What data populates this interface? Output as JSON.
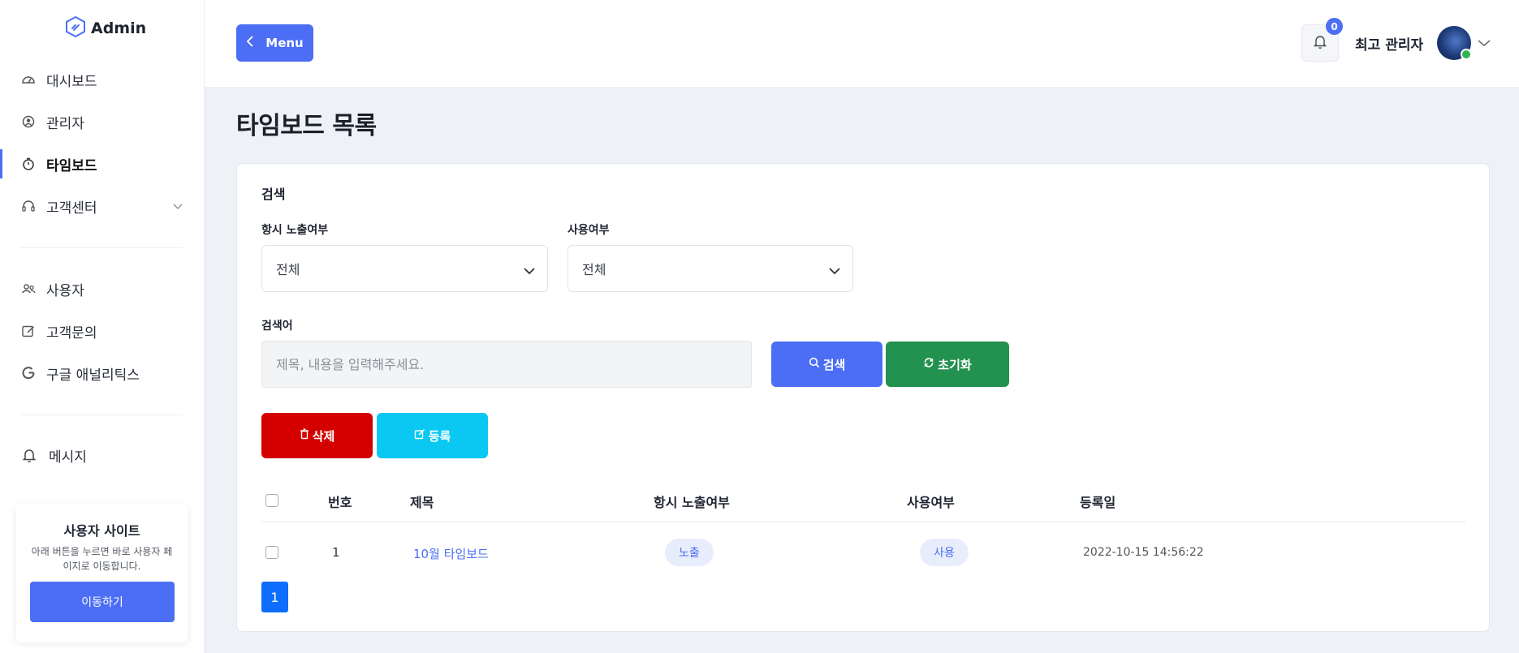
{
  "brand": {
    "name": "Admin"
  },
  "sidebar": {
    "items": [
      {
        "label": "대시보드",
        "icon": "dashboard-gauge-icon"
      },
      {
        "label": "관리자",
        "icon": "admin-icon"
      },
      {
        "label": "타임보드",
        "icon": "stopwatch-icon",
        "active": true
      },
      {
        "label": "고객센터",
        "icon": "headset-icon",
        "expandable": true
      },
      {
        "label": "사용자",
        "icon": "users-icon"
      },
      {
        "label": "고객문의",
        "icon": "edit-note-icon"
      },
      {
        "label": "구글 애널리틱스",
        "icon": "google-icon"
      },
      {
        "label": "메시지",
        "icon": "bell-icon"
      }
    ],
    "user_site": {
      "title": "사용자 사이트",
      "desc": "아래 버튼을 누르면 바로 사용자 페이지로 이동합니다.",
      "button": "이동하기"
    }
  },
  "header": {
    "menu_label": "Menu",
    "notification_count": "0",
    "admin_name": "최고 관리자"
  },
  "page": {
    "title": "타임보드 목록"
  },
  "search": {
    "section_label": "검색",
    "always_show_label": "항시 노출여부",
    "always_show_value": "전체",
    "use_label": "사용여부",
    "use_value": "전체",
    "keyword_label": "검색어",
    "keyword_placeholder": "제목, 내용을 입력해주세요.",
    "search_button": "검색",
    "reset_button": "초기화"
  },
  "actions": {
    "delete_button": "삭제",
    "register_button": "등록"
  },
  "table": {
    "headers": [
      "번호",
      "제목",
      "항시 노출여부",
      "사용여부",
      "등록일"
    ],
    "rows": [
      {
        "no": "1",
        "title": "10월 타임보드",
        "always_show": "노출",
        "use": "사용",
        "date": "2022-10-15 14:56:22"
      }
    ]
  },
  "pagination": {
    "current": "1"
  },
  "colors": {
    "primary": "#4c6ef5",
    "success": "#23914f",
    "danger": "#d40000",
    "info": "#0ac8f2",
    "page_active": "#0d6efd"
  }
}
